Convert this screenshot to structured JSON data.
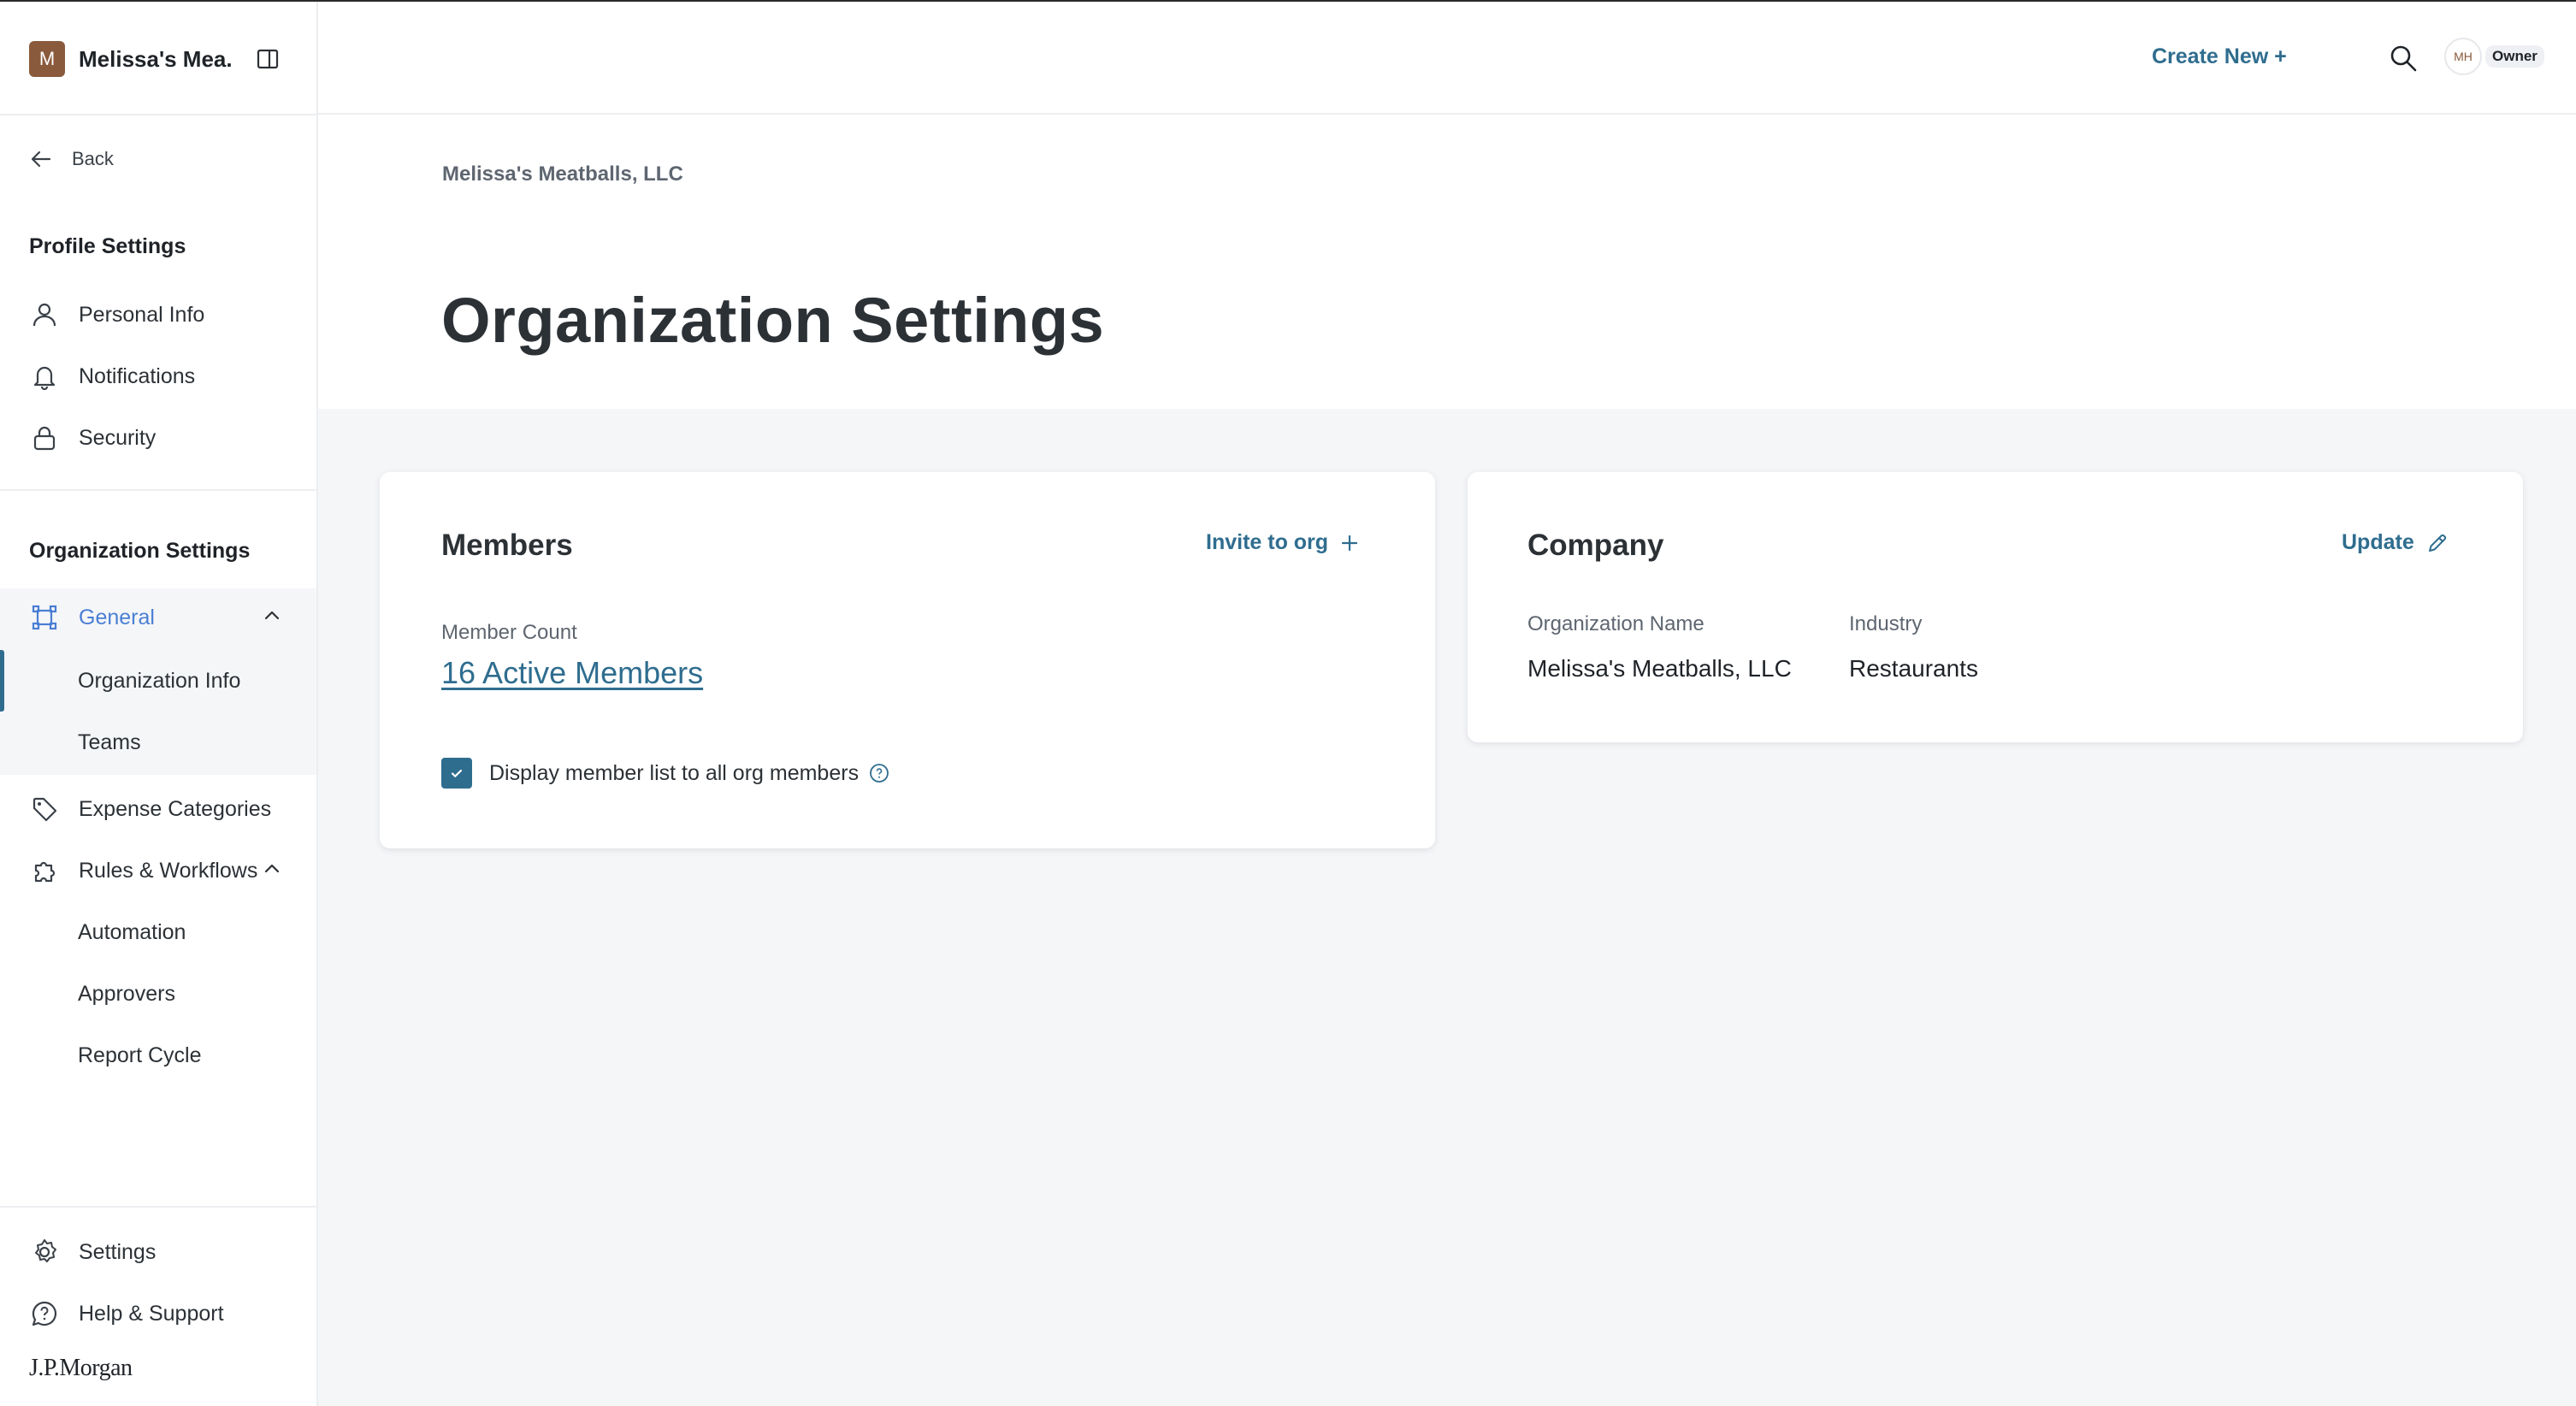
{
  "org_switcher": {
    "initial": "M",
    "name": "Melissa's Mea..."
  },
  "sidebar": {
    "back_label": "Back",
    "profile_section_title": "Profile Settings",
    "profile_items": [
      {
        "label": "Personal Info",
        "icon": "person-icon"
      },
      {
        "label": "Notifications",
        "icon": "bell-icon"
      },
      {
        "label": "Security",
        "icon": "lock-icon"
      }
    ],
    "org_section_title": "Organization Settings",
    "general": {
      "label": "General",
      "icon": "building-icon",
      "expanded": true,
      "children": [
        "Organization Info",
        "Teams"
      ],
      "active_child": "Organization Info"
    },
    "expense_categories_label": "Expense Categories",
    "rules": {
      "label": "Rules & Workflows",
      "expanded": true,
      "children": [
        "Automation",
        "Approvers",
        "Report Cycle"
      ]
    },
    "settings_label": "Settings",
    "help_label": "Help & Support",
    "brand": "J.P.Morgan"
  },
  "header": {
    "create_new_label": "Create New +",
    "user_initials": "MH",
    "user_role": "Owner"
  },
  "page": {
    "breadcrumb": "Melissa's Meatballs, LLC",
    "title": "Organization Settings"
  },
  "members_card": {
    "title": "Members",
    "invite_label": "Invite to org",
    "member_count_label": "Member Count",
    "member_count_value": "16 Active Members",
    "checkbox_label": "Display member list to all org members",
    "checkbox_checked": true
  },
  "company_card": {
    "title": "Company",
    "update_label": "Update",
    "org_name_label": "Organization Name",
    "org_name_value": "Melissa's Meatballs, LLC",
    "industry_label": "Industry",
    "industry_value": "Restaurants"
  },
  "colors": {
    "accent": "#2f6d8f",
    "general_active": "#4a7fd4",
    "avatar_brown": "#8a5a3c",
    "content_bg": "#f5f6f8"
  }
}
